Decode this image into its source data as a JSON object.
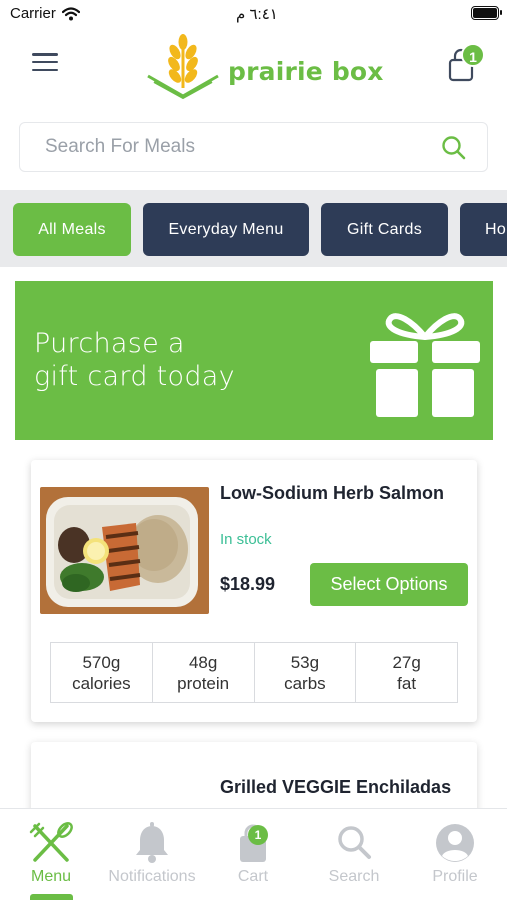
{
  "status_bar": {
    "carrier": "Carrier",
    "time": "٦:٤١ م"
  },
  "header": {
    "brand": "prairie box",
    "cart_count": "1"
  },
  "search": {
    "placeholder": "Search For Meals"
  },
  "categories": [
    {
      "label": "All Meals",
      "active": true
    },
    {
      "label": "Everyday Menu",
      "active": false
    },
    {
      "label": "Gift Cards",
      "active": false
    },
    {
      "label": "Ho",
      "active": false
    }
  ],
  "banner": {
    "line1": "Purchase a",
    "line2": "gift card today"
  },
  "meals": [
    {
      "title": "Low-Sodium Herb Salmon",
      "stock": "In stock",
      "price": "$18.99",
      "button": "Select Options",
      "nutrition": [
        {
          "value": "570g",
          "label": "calories"
        },
        {
          "value": "48g",
          "label": "protein"
        },
        {
          "value": "53g",
          "label": "carbs"
        },
        {
          "value": "27g",
          "label": "fat"
        }
      ]
    },
    {
      "title": "Grilled VEGGIE Enchiladas"
    }
  ],
  "tabs": [
    {
      "label": "Menu",
      "icon": "fork-knife-icon",
      "active": true
    },
    {
      "label": "Notifications",
      "icon": "bell-icon",
      "active": false
    },
    {
      "label": "Cart",
      "icon": "bag-icon",
      "active": false,
      "badge": "1"
    },
    {
      "label": "Search",
      "icon": "search-icon",
      "active": false
    },
    {
      "label": "Profile",
      "icon": "user-icon",
      "active": false
    }
  ],
  "colors": {
    "brand_green": "#6bbd45",
    "navy": "#2e3c57",
    "stock_teal": "#3cbf96"
  }
}
